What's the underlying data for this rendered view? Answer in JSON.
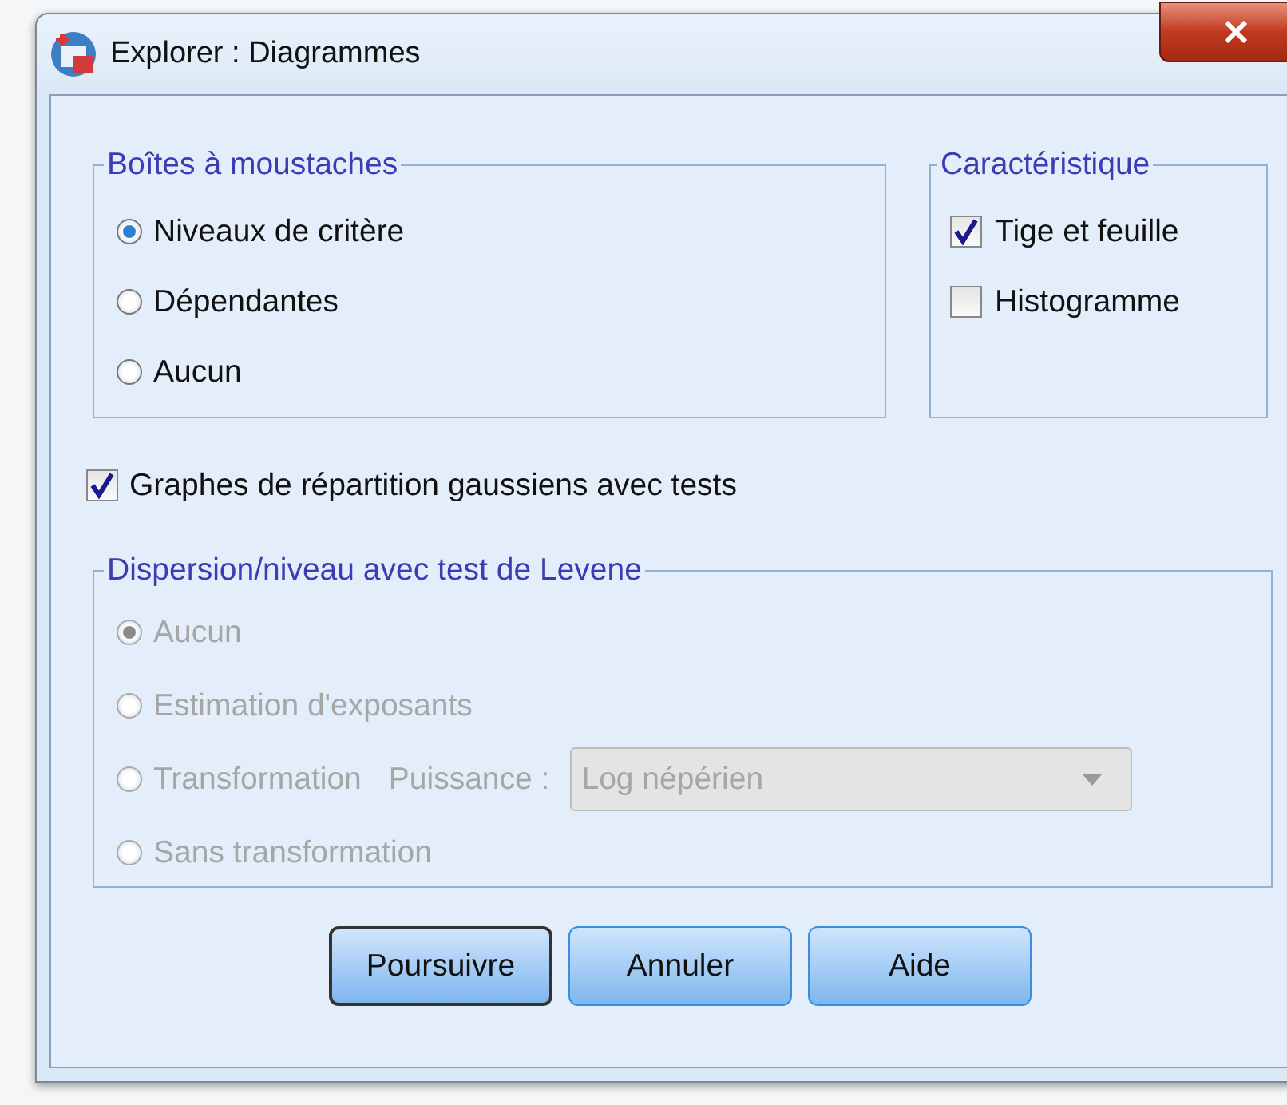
{
  "window": {
    "title": "Explorer : Diagrammes"
  },
  "boxplots": {
    "title": "Boîtes à moustaches",
    "options": [
      {
        "label": "Niveaux de critère",
        "selected": true
      },
      {
        "label": "Dépendantes",
        "selected": false
      },
      {
        "label": "Aucun",
        "selected": false
      }
    ]
  },
  "descriptive": {
    "title": "Caractéristique",
    "options": [
      {
        "label": "Tige et feuille",
        "checked": true
      },
      {
        "label": "Histogramme",
        "checked": false
      }
    ]
  },
  "normality": {
    "label": "Graphes de répartition gaussiens avec tests",
    "checked": true
  },
  "spread_vs_level": {
    "title": "Dispersion/niveau avec test de Levene",
    "disabled": true,
    "options": [
      {
        "label": "Aucun",
        "selected": true
      },
      {
        "label": "Estimation d'exposants",
        "selected": false
      },
      {
        "label": "Transformation",
        "selected": false
      },
      {
        "label": "Sans transformation",
        "selected": false
      }
    ],
    "power": {
      "label": "Puissance :",
      "value": "Log népérien"
    }
  },
  "buttons": [
    {
      "label": "Poursuivre",
      "default": true
    },
    {
      "label": "Annuler",
      "default": false
    },
    {
      "label": "Aide",
      "default": false
    }
  ]
}
